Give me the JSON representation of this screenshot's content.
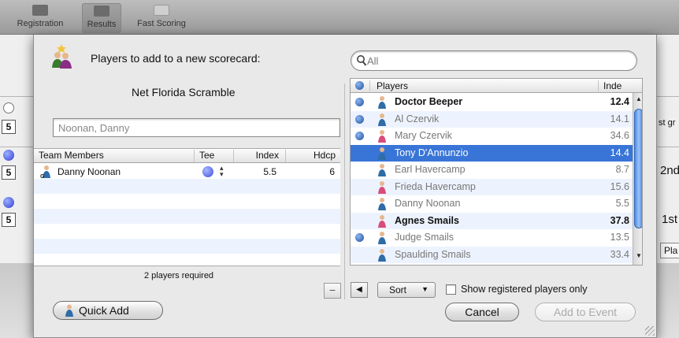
{
  "toolbar": {
    "registration": "Registration",
    "results": "Results",
    "fast_scoring": "Fast Scoring"
  },
  "background": {
    "box_a": "5",
    "box_b": "5",
    "box_c": "5",
    "right_a": "st gr",
    "right_b": "2nd",
    "right_c": "1st",
    "right_d": "Pla"
  },
  "sheet": {
    "title": "Players to add to a new scorecard:",
    "event_name": "Net Florida Scramble",
    "name_field_value": "Noonan, Danny",
    "team_table": {
      "headers": [
        "Team Members",
        "Tee",
        "Index",
        "Hdcp"
      ],
      "rows": [
        {
          "name": "Danny Noonan",
          "tee_color": "#3f4fe0",
          "index": "5.5",
          "hdcp": "6"
        }
      ]
    },
    "requirement": "2 players required",
    "search": {
      "placeholder": "All",
      "value": "All"
    },
    "players_table": {
      "headers": [
        "Players",
        "Inde"
      ],
      "rows": [
        {
          "name": "Doctor Beeper",
          "index": "12.4",
          "registered": true,
          "gender": "male",
          "state": "bold"
        },
        {
          "name": "Al Czervik",
          "index": "14.1",
          "registered": true,
          "gender": "male",
          "state": "gray"
        },
        {
          "name": "Mary Czervik",
          "index": "34.6",
          "registered": true,
          "gender": "female",
          "state": "gray"
        },
        {
          "name": "Tony D'Annunzio",
          "index": "14.4",
          "registered": false,
          "gender": "male",
          "state": "selected"
        },
        {
          "name": "Earl Havercamp",
          "index": "8.7",
          "registered": false,
          "gender": "male",
          "state": "gray"
        },
        {
          "name": "Frieda Havercamp",
          "index": "15.6",
          "registered": false,
          "gender": "female",
          "state": "gray"
        },
        {
          "name": "Danny Noonan",
          "index": "5.5",
          "registered": false,
          "gender": "male",
          "state": "gray"
        },
        {
          "name": "Agnes Smails",
          "index": "37.8",
          "registered": false,
          "gender": "female",
          "state": "bold"
        },
        {
          "name": "Judge Smails",
          "index": "13.5",
          "registered": true,
          "gender": "male",
          "state": "gray"
        },
        {
          "name": "Spaulding Smails",
          "index": "33.4",
          "registered": false,
          "gender": "male",
          "state": "gray"
        }
      ]
    },
    "sort_label": "Sort",
    "show_registered_label": "Show registered players only",
    "show_registered_checked": false,
    "quick_add_label": "Quick Add",
    "cancel_label": "Cancel",
    "add_to_event_label": "Add to Event"
  },
  "colors": {
    "selection": "#3875d7",
    "alt_row": "#edf3fe",
    "registered_dot": "#1d4f9c"
  }
}
